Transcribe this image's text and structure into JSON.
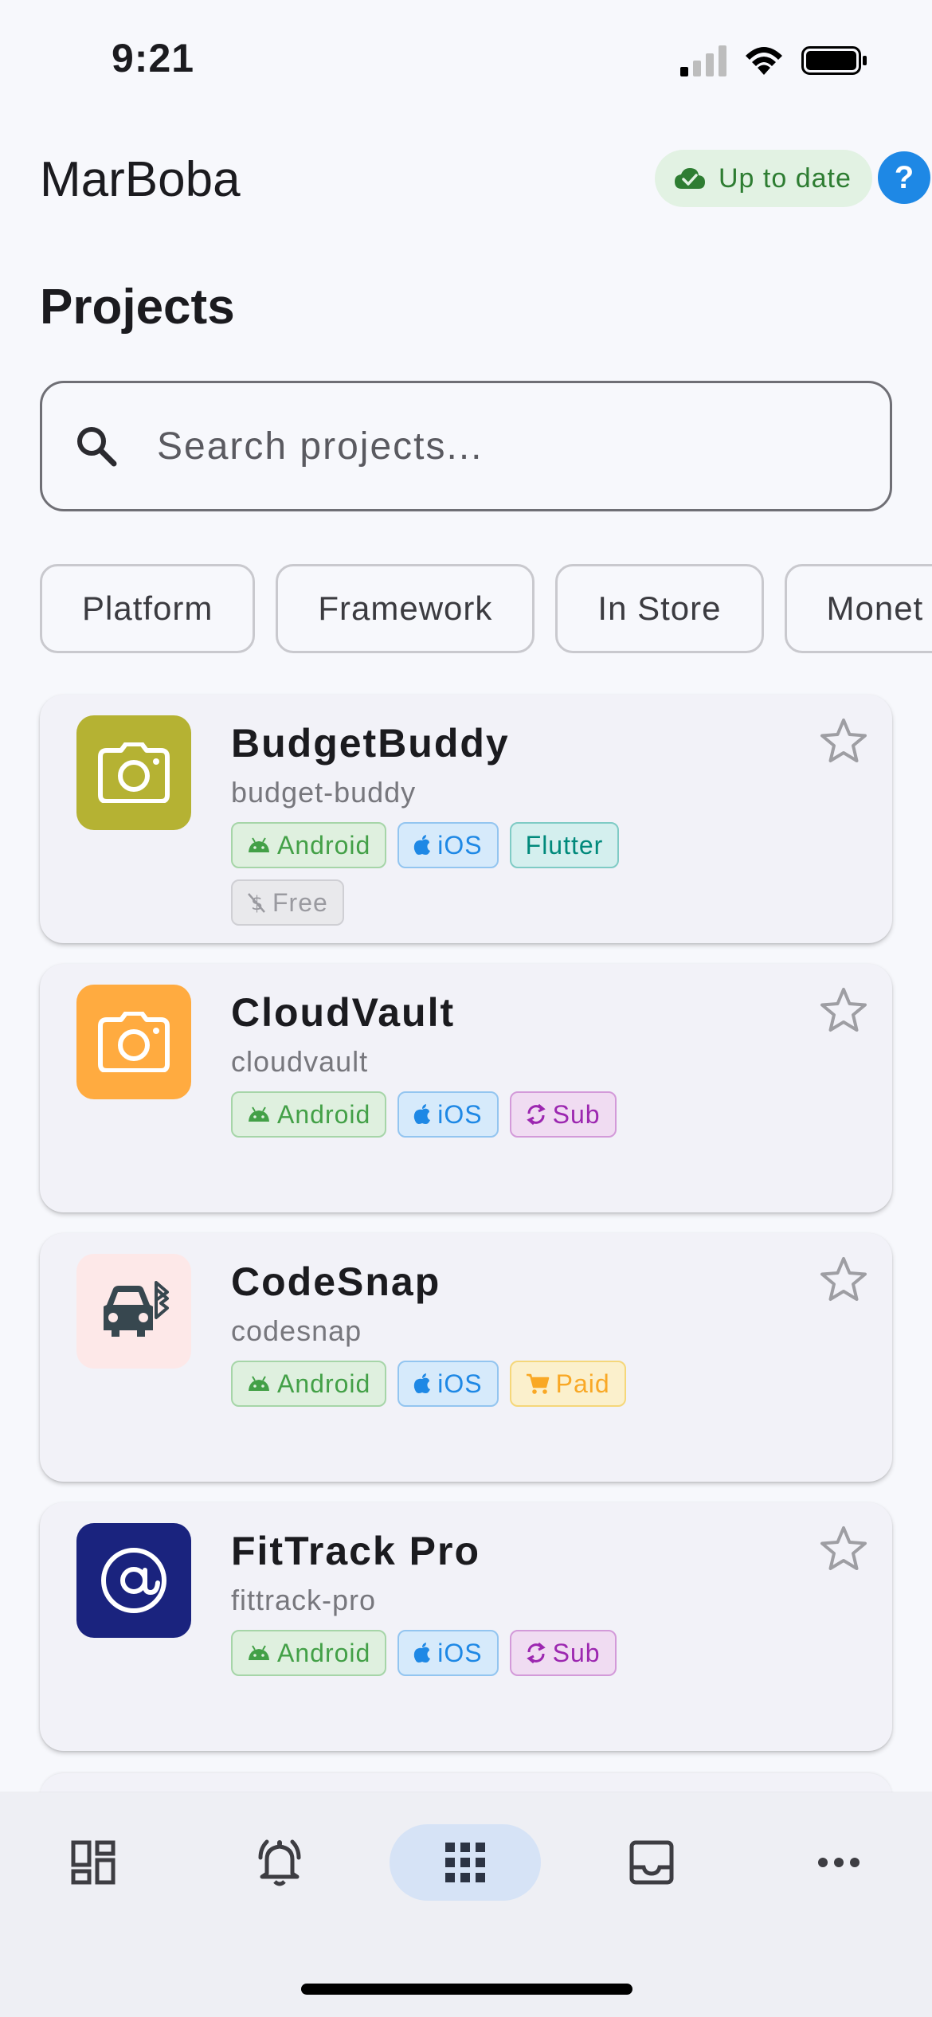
{
  "status_bar": {
    "time": "9:21"
  },
  "header": {
    "app_title": "MarBoba",
    "sync_status": "Up to date",
    "help_label": "?"
  },
  "page": {
    "title": "Projects"
  },
  "search": {
    "placeholder": "Search projects...",
    "value": ""
  },
  "filters": [
    {
      "label": "Platform"
    },
    {
      "label": "Framework"
    },
    {
      "label": "In Store"
    },
    {
      "label": "Monet"
    }
  ],
  "projects": [
    {
      "name": "BudgetBuddy",
      "slug": "budget-buddy",
      "icon": "camera-icon",
      "icon_bg": "#b5b233",
      "icon_fg": "#ffffff",
      "tags": [
        {
          "type": "android",
          "label": "Android"
        },
        {
          "type": "ios",
          "label": "iOS"
        },
        {
          "type": "flutter",
          "label": "Flutter"
        },
        {
          "type": "free",
          "label": "Free"
        }
      ]
    },
    {
      "name": "CloudVault",
      "slug": "cloudvault",
      "icon": "camera-icon",
      "icon_bg": "#ffab40",
      "icon_fg": "#ffffff",
      "tags": [
        {
          "type": "android",
          "label": "Android"
        },
        {
          "type": "ios",
          "label": "iOS"
        },
        {
          "type": "sub",
          "label": "Sub"
        }
      ]
    },
    {
      "name": "CodeSnap",
      "slug": "codesnap",
      "icon": "car-bluetooth-icon",
      "icon_bg": "#fde8e8",
      "icon_fg": "#37474f",
      "tags": [
        {
          "type": "android",
          "label": "Android"
        },
        {
          "type": "ios",
          "label": "iOS"
        },
        {
          "type": "paid",
          "label": "Paid"
        }
      ]
    },
    {
      "name": "FitTrack Pro",
      "slug": "fittrack-pro",
      "icon": "at-sign-icon",
      "icon_bg": "#1a237e",
      "icon_fg": "#ffffff",
      "tags": [
        {
          "type": "android",
          "label": "Android"
        },
        {
          "type": "ios",
          "label": "iOS"
        },
        {
          "type": "sub",
          "label": "Sub"
        }
      ]
    }
  ],
  "bottom_nav": [
    {
      "icon": "dashboard-icon",
      "active": false
    },
    {
      "icon": "bell-ring-icon",
      "active": false
    },
    {
      "icon": "apps-grid-icon",
      "active": true
    },
    {
      "icon": "inbox-icon",
      "active": false
    },
    {
      "icon": "more-horiz-icon",
      "active": false
    }
  ],
  "colors": {
    "accent": "#1e88e5",
    "success": "#2e7d32",
    "background": "#f7f8fc",
    "card": "#f2f2f8"
  }
}
